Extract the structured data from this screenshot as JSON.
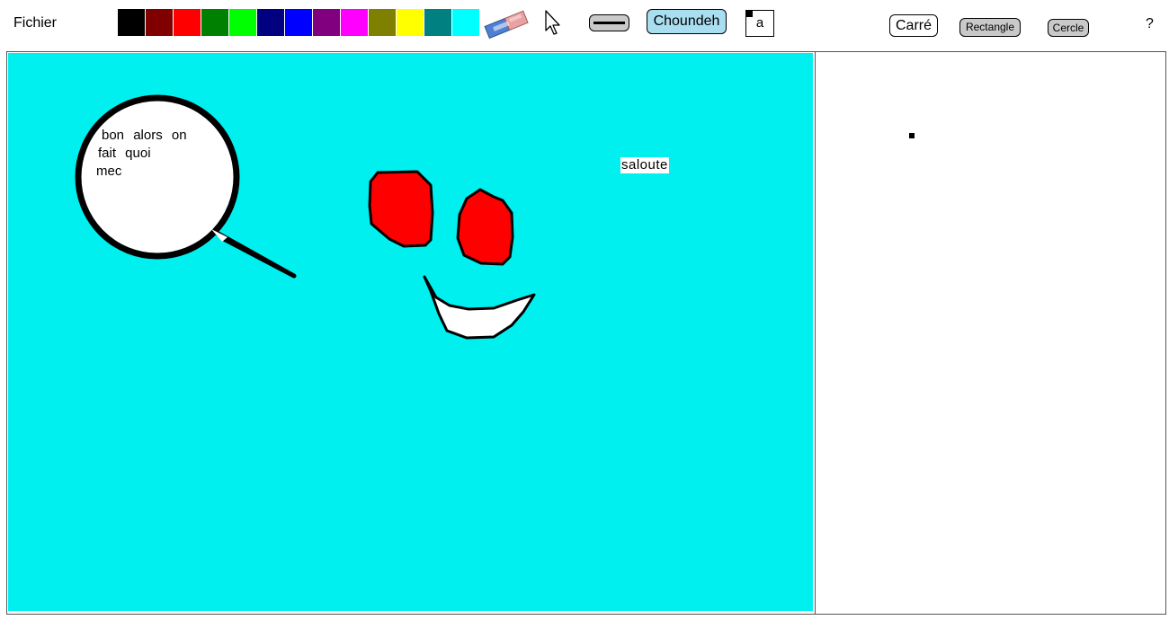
{
  "menu": {
    "file_label": "Fichier"
  },
  "palette": {
    "colors": [
      "#000000",
      "#800000",
      "#ff0000",
      "#008000",
      "#00ff00",
      "#000080",
      "#0000ff",
      "#800080",
      "#ff00ff",
      "#808000",
      "#ffff00",
      "#008080",
      "#00ffff"
    ]
  },
  "toolbar": {
    "eraser_icon": "eraser-icon",
    "pointer_icon": "cursor-arrow-icon",
    "line_icon": "line-thickness-icon",
    "font_label": "Choundeh",
    "text_tool_label": "a",
    "square_label": "Carré",
    "rectangle_label": "Rectangle",
    "circle_label": "Cercle",
    "help_label": "?"
  },
  "canvas": {
    "background": "#00f0f0",
    "speech_bubble": {
      "lines": [
        "bon alors on",
        "fait quoi",
        "mec"
      ]
    },
    "floating_text": "saloute",
    "eye_color": "#ff0000",
    "mouth_color": "#ffffff"
  }
}
